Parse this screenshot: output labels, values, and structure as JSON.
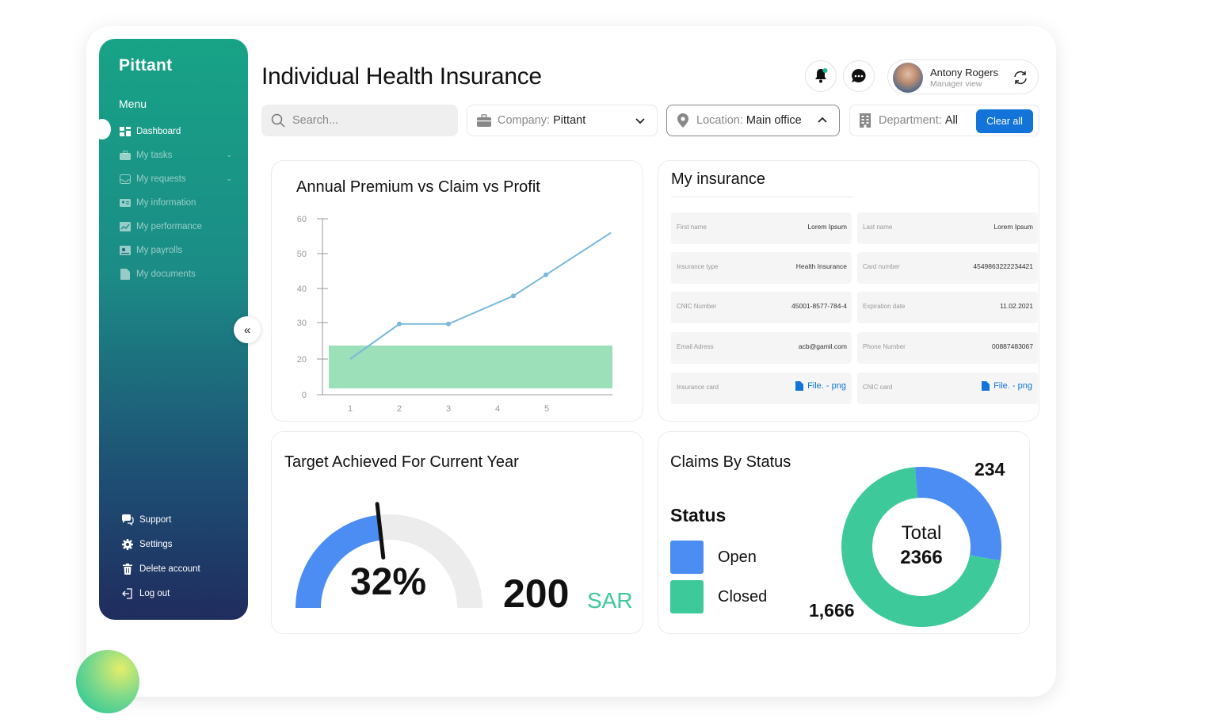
{
  "app": {
    "logo": "Pittant",
    "menu_title": "Menu"
  },
  "sidebar": {
    "items": [
      {
        "label": "Dashboard",
        "icon": "dashboard-icon",
        "active": true
      },
      {
        "label": "My tasks",
        "icon": "briefcase-icon",
        "has_chevron": true
      },
      {
        "label": "My requests",
        "icon": "inbox-icon",
        "has_chevron": true
      },
      {
        "label": "My information",
        "icon": "id-card-icon"
      },
      {
        "label": "My performance",
        "icon": "chart-icon"
      },
      {
        "label": "My payrolls",
        "icon": "payroll-icon"
      },
      {
        "label": "My documents",
        "icon": "document-icon"
      }
    ],
    "bottom": [
      {
        "label": "Support",
        "icon": "chat-support-icon"
      },
      {
        "label": "Settings",
        "icon": "gear-icon"
      },
      {
        "label": "Delete account",
        "icon": "trash-icon"
      },
      {
        "label": "Log out",
        "icon": "logout-icon"
      }
    ]
  },
  "header": {
    "title": "Individual Health Insurance",
    "user": {
      "name": "Antony Rogers",
      "role": "Manager view"
    }
  },
  "filters": {
    "search_placeholder": "Search...",
    "company_label": "Company:",
    "company_value": "Pittant",
    "location_label": "Location:",
    "location_value": "Main office",
    "department_label": "Department:",
    "department_value": "All",
    "clear_label": "Clear all"
  },
  "premium_card": {
    "title": "Annual Premium vs Claim vs Profit"
  },
  "chart_data": [
    {
      "type": "line",
      "title": "Annual Premium vs Claim vs Profit",
      "xlabel": "",
      "ylabel": "",
      "x_ticks": [
        "1",
        "2",
        "3",
        "4",
        "5"
      ],
      "y_ticks": [
        "0",
        "20",
        "30",
        "40",
        "50",
        "60"
      ],
      "ylim": [
        0,
        60
      ],
      "grid": false,
      "band": {
        "from": 0,
        "to": 20,
        "color": "#9be0b8"
      },
      "series": [
        {
          "color": "#7ab8dc",
          "points": [
            [
              1,
              20
            ],
            [
              2,
              30
            ],
            [
              3,
              30
            ],
            [
              4,
              38
            ],
            [
              4.5,
              44
            ],
            [
              5.5,
              56
            ]
          ]
        }
      ]
    },
    {
      "type": "gauge",
      "title": "Target Achieved For Current Year",
      "value": 32,
      "max": 100,
      "center_label": "32%",
      "amount": "200",
      "currency": "SAR",
      "colors": {
        "fill": "#4b8df2",
        "track": "#ececec"
      }
    },
    {
      "type": "pie",
      "title": "Claims By Status",
      "legend_title": "Status",
      "center_label": "Total",
      "total": "2366",
      "slices": [
        {
          "label": "Open",
          "value": 234,
          "display": "234",
          "color": "#4b8df2"
        },
        {
          "label": "Closed",
          "value": 1666,
          "display": "1,666",
          "color": "#3ec99a"
        }
      ]
    }
  ],
  "insurance": {
    "title": "My insurance",
    "fields": [
      {
        "label": "First name",
        "value": "Lorem Ipsum"
      },
      {
        "label": "Last name",
        "value": "Lorem Ipsum"
      },
      {
        "label": "Insurance type",
        "value": "Health Insurance"
      },
      {
        "label": "Card number",
        "value": "4549863222234421"
      },
      {
        "label": "CNIC Number",
        "value": "45001-8577-784-4"
      },
      {
        "label": "Expiration date",
        "value": "11.02.2021"
      },
      {
        "label": "Email Adress",
        "value": "acb@gamil.com"
      },
      {
        "label": "Phone Number",
        "value": "00887483067"
      },
      {
        "label": "Insurance card",
        "value": "File. - png",
        "is_file": true
      },
      {
        "label": "CNIC card",
        "value": "File. - png",
        "is_file": true
      }
    ]
  },
  "target_card": {
    "title": "Target Achieved For Current Year",
    "percent": "32%",
    "amount": "200",
    "currency": "SAR"
  },
  "claims_card": {
    "title": "Claims By Status",
    "legend_title": "Status",
    "open_label": "Open",
    "closed_label": "Closed",
    "open_value": "234",
    "closed_value": "1,666",
    "center_top": "Total",
    "center_bottom": "2366"
  }
}
